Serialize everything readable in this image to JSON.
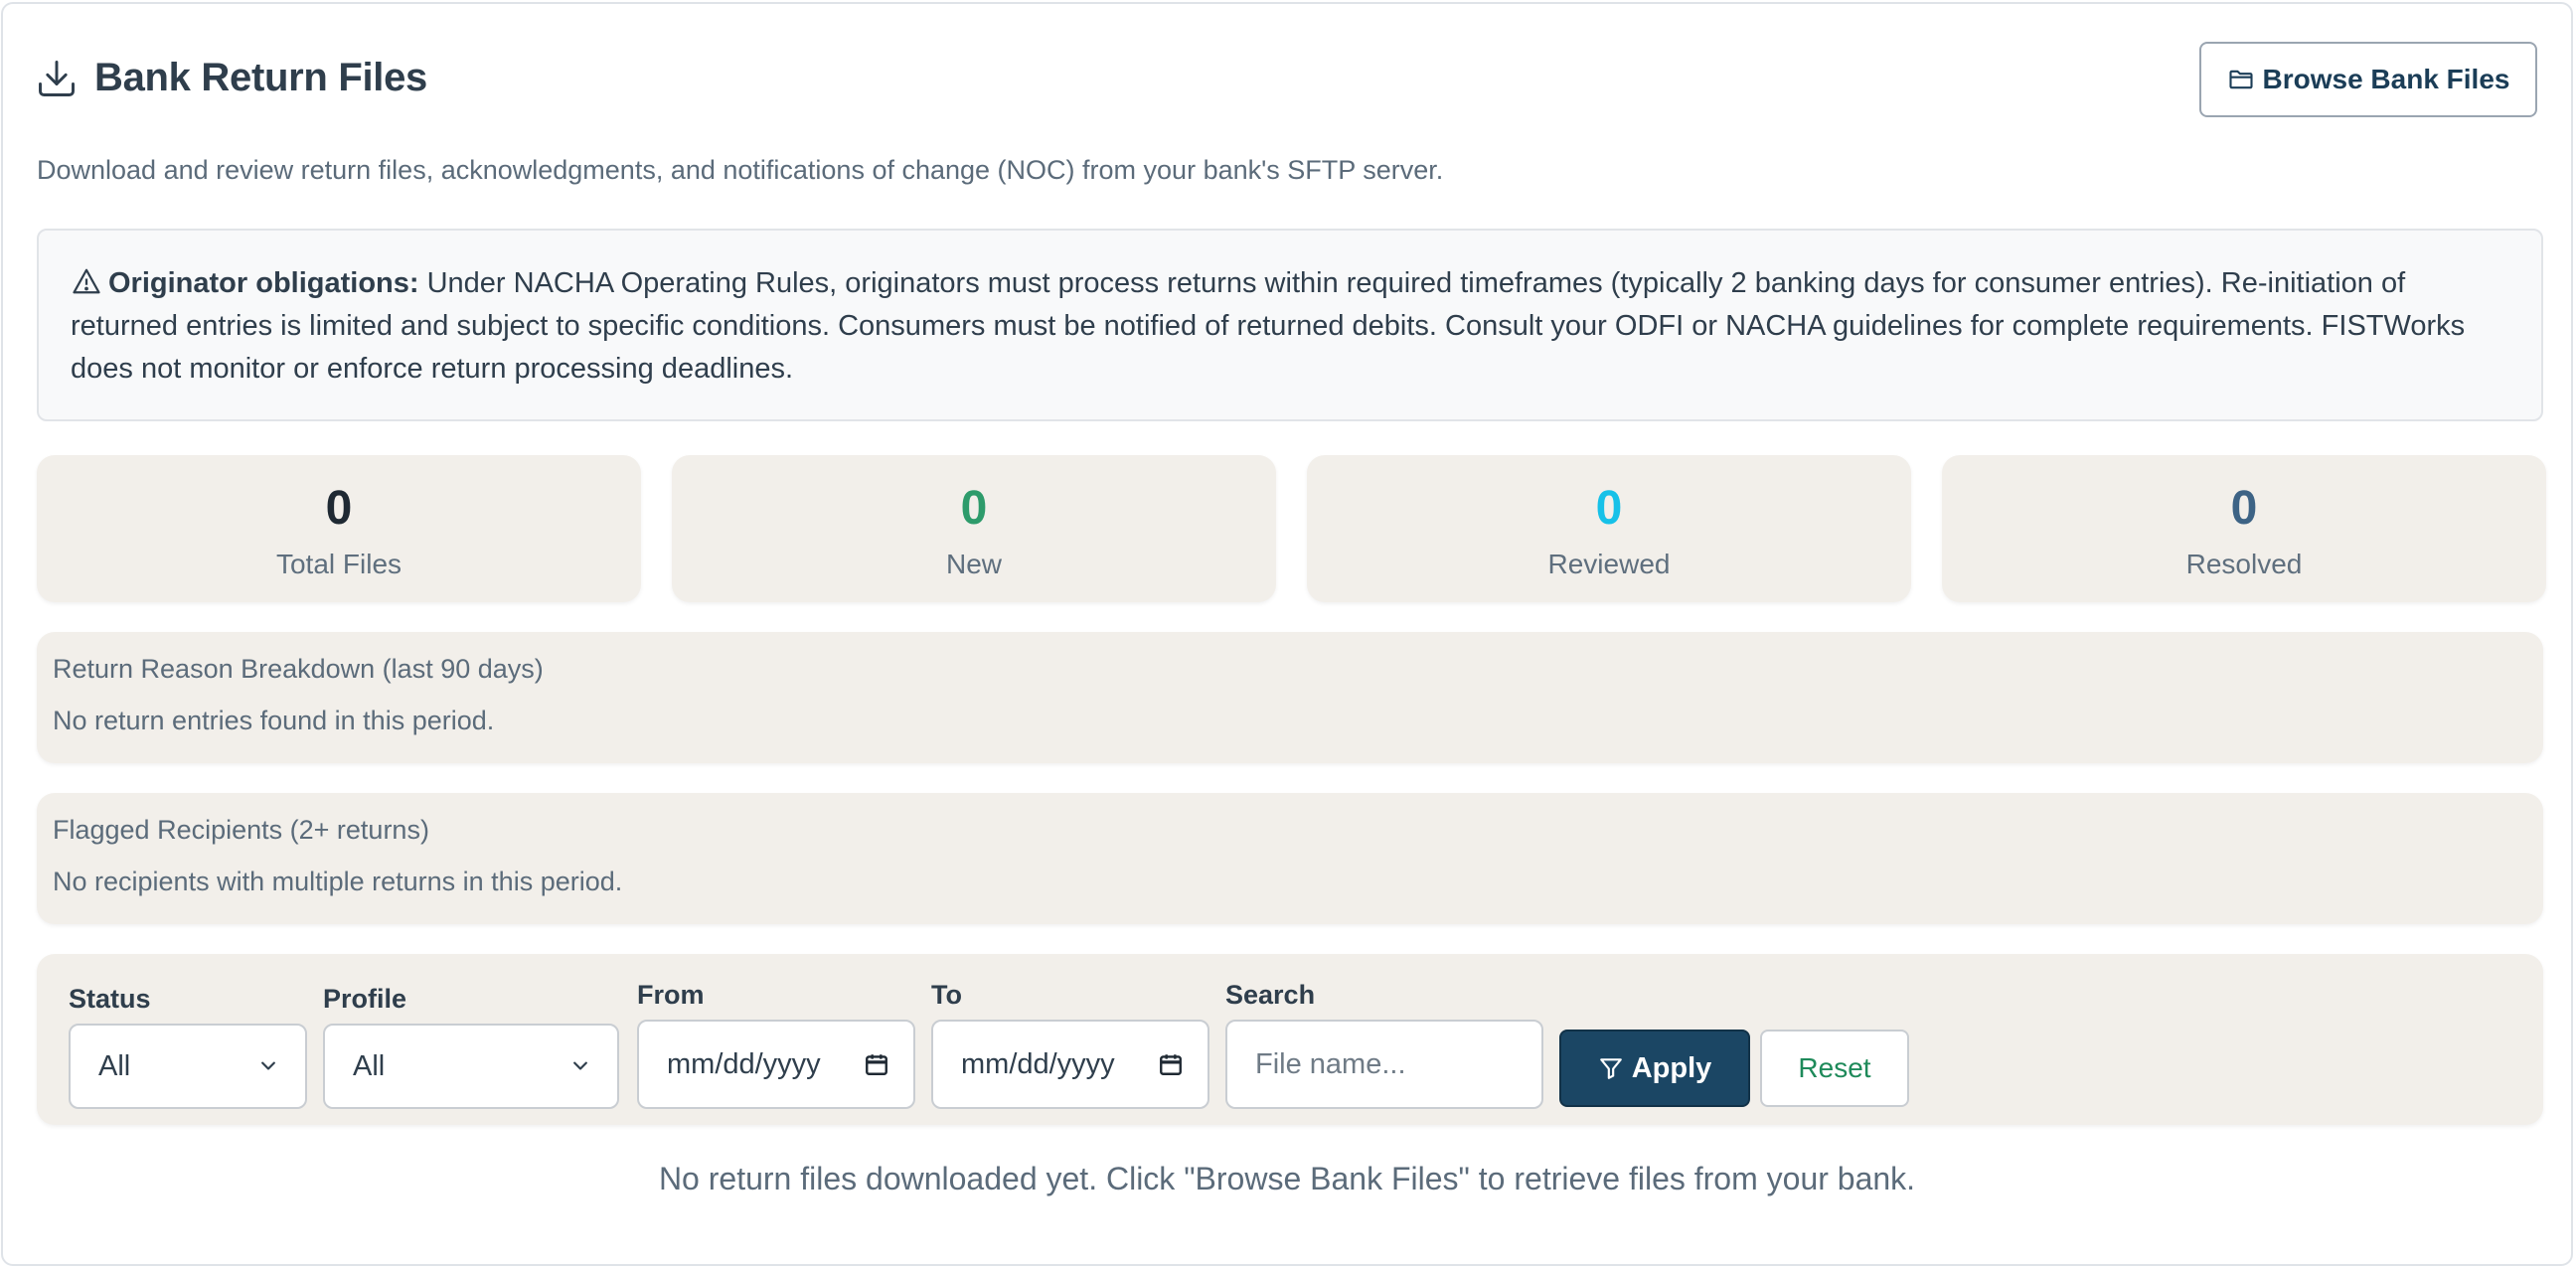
{
  "header": {
    "title": "Bank Return Files",
    "browse_button_label": "Browse Bank Files"
  },
  "subtitle": "Download and review return files, acknowledgments, and notifications of change (NOC) from your bank's SFTP server.",
  "notice": {
    "bold_label": "Originator obligations:",
    "text": " Under NACHA Operating Rules, originators must process returns within required timeframes (typically 2 banking days for consumer entries). Re-initiation of returned entries is limited and subject to specific conditions. Consumers must be notified of returned debits. Consult your ODFI or NACHA guidelines for complete requirements. FISTWorks does not monitor or enforce return processing deadlines."
  },
  "stats": [
    {
      "value": "0",
      "label": "Total Files",
      "color": "#1f2933"
    },
    {
      "value": "0",
      "label": "New",
      "color": "#2e9b6b"
    },
    {
      "value": "0",
      "label": "Reviewed",
      "color": "#17c1e8"
    },
    {
      "value": "0",
      "label": "Resolved",
      "color": "#3d6385"
    }
  ],
  "return_reasons": {
    "title": "Return Reason Breakdown (last 90 days)",
    "empty": "No return entries found in this period."
  },
  "flagged": {
    "title": "Flagged Recipients (2+ returns)",
    "empty": "No recipients with multiple returns in this period."
  },
  "filters": {
    "status_label": "Status",
    "status_value": "All",
    "profile_label": "Profile",
    "profile_value": "All",
    "from_label": "From",
    "from_placeholder": "mm/dd/yyyy",
    "to_label": "To",
    "to_placeholder": "mm/dd/yyyy",
    "search_label": "Search",
    "search_placeholder": "File name...",
    "apply_label": "Apply",
    "reset_label": "Reset"
  },
  "empty_message": "No return files downloaded yet. Click \"Browse Bank Files\" to retrieve files from your bank.",
  "colors": {
    "primary": "#1b4664",
    "reset_text": "#1e8a5a",
    "panel_bg": "#f2efea"
  }
}
